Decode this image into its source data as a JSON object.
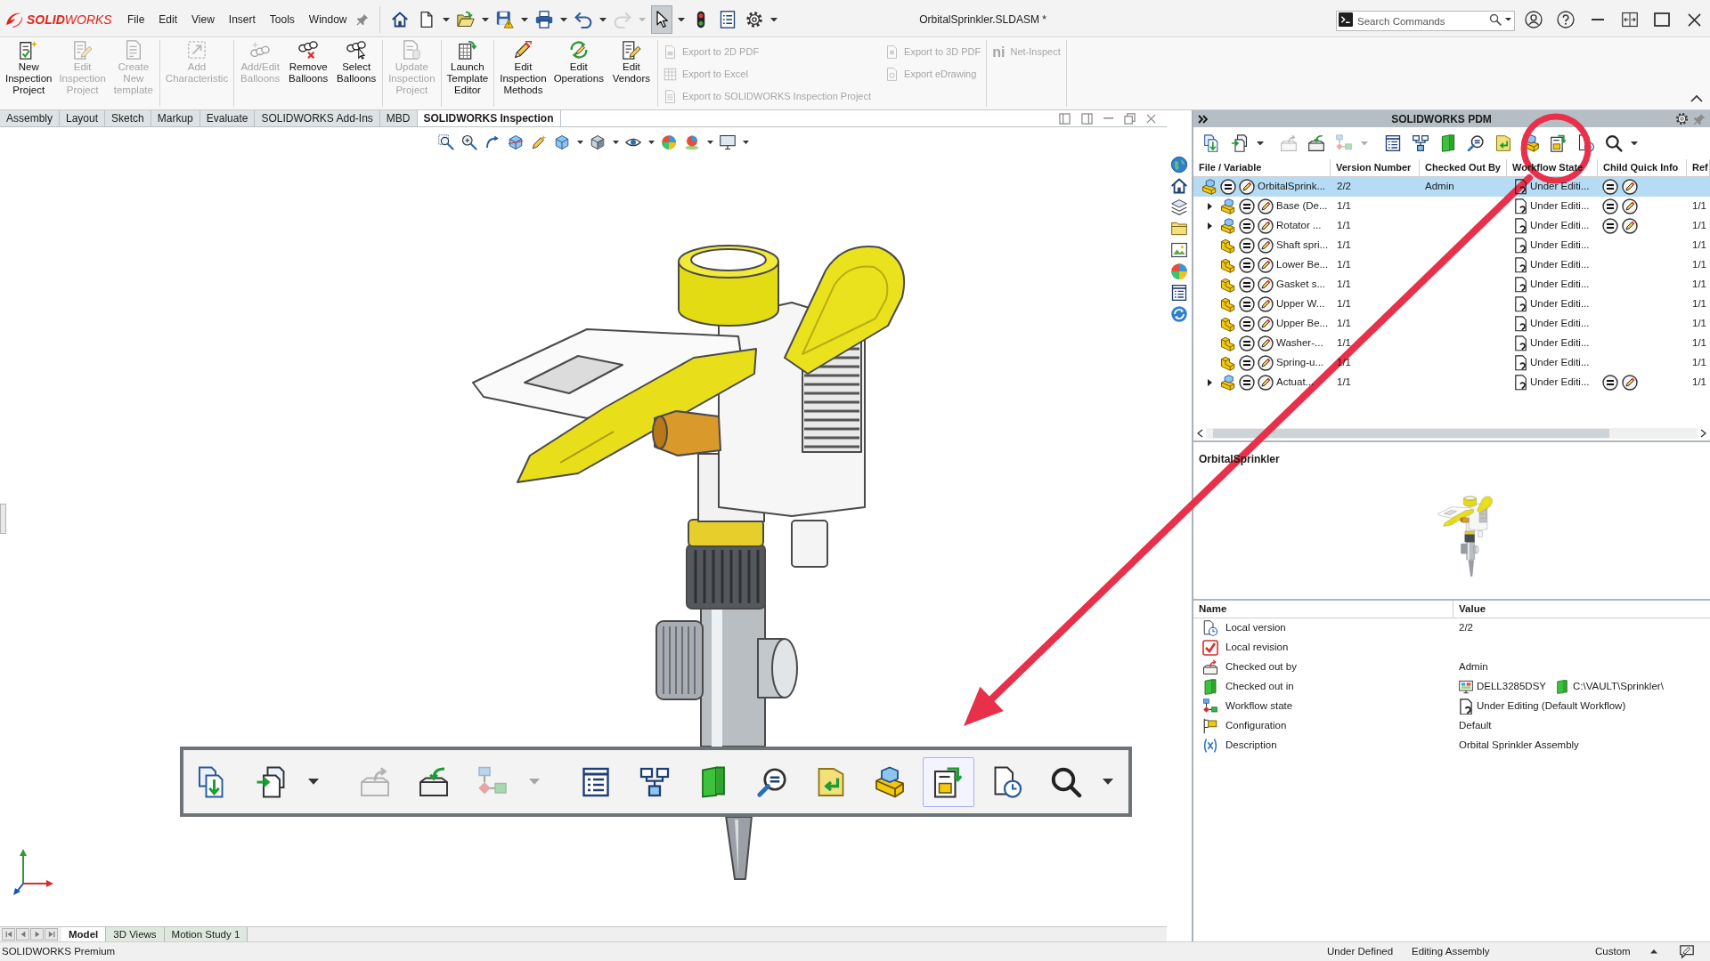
{
  "title_bar": {
    "logo": "**SOLID**WORKS",
    "menu": [
      "File",
      "Edit",
      "View",
      "Insert",
      "Tools",
      "Window"
    ],
    "quick_access": [
      {
        "kind": "button",
        "disabled": false,
        "selected": false
      },
      {
        "kind": "button",
        "disabled": false,
        "selected": false
      },
      {
        "kind": "arrow",
        "disabled": false,
        "selected": false
      },
      {
        "kind": "button",
        "disabled": false,
        "selected": false
      },
      {
        "kind": "arrow",
        "disabled": false,
        "selected": false
      },
      {
        "kind": "button",
        "disabled": false,
        "selected": false
      },
      {
        "kind": "arrow",
        "disabled": false,
        "selected": false
      },
      {
        "kind": "button",
        "disabled": false,
        "selected": false
      },
      {
        "kind": "arrow",
        "disabled": false,
        "selected": false
      },
      {
        "kind": "button",
        "disabled": false,
        "selected": false
      },
      {
        "kind": "arrow",
        "disabled": false,
        "selected": false
      },
      {
        "kind": "button",
        "disabled": true,
        "selected": false
      },
      {
        "kind": "arrow",
        "disabled": true,
        "selected": false
      },
      {
        "kind": "button",
        "disabled": false,
        "selected": true
      },
      {
        "kind": "arrow",
        "disabled": false,
        "selected": false
      },
      {
        "kind": "button",
        "disabled": false,
        "selected": false
      },
      {
        "kind": "button",
        "disabled": false,
        "selected": false
      },
      {
        "kind": "button",
        "disabled": false,
        "selected": false
      },
      {
        "kind": "arrow",
        "disabled": false,
        "selected": false
      }
    ],
    "document_title": "OrbitalSprinkler.SLDASM *",
    "search": {
      "placeholder": "Search Commands"
    }
  },
  "ribbon": {
    "groups": [
      {
        "kind": "large",
        "buttons": [
          {
            "label": "New Inspection Project",
            "disabled": false
          },
          {
            "label": "Edit Inspection Project",
            "disabled": true
          },
          {
            "label": "Create New template",
            "disabled": true
          }
        ]
      },
      {
        "kind": "large",
        "buttons": [
          {
            "label": "Add Characteristic",
            "disabled": true
          }
        ]
      },
      {
        "kind": "large",
        "buttons": [
          {
            "label": "Add/Edit Balloons",
            "disabled": true
          },
          {
            "label": "Remove Balloons",
            "disabled": false
          },
          {
            "label": "Select Balloons",
            "disabled": false
          }
        ]
      },
      {
        "kind": "large",
        "buttons": [
          {
            "label": "Update Inspection Project",
            "disabled": true
          }
        ]
      },
      {
        "kind": "large",
        "buttons": [
          {
            "label": "Launch Template Editor",
            "disabled": false
          }
        ]
      },
      {
        "kind": "large",
        "buttons": [
          {
            "label": "Edit Inspection Methods",
            "disabled": false
          },
          {
            "label": "Edit Operations",
            "disabled": false
          },
          {
            "label": "Edit Vendors",
            "disabled": false
          }
        ]
      },
      {
        "kind": "small",
        "columns": [
          [
            {
              "label": "Export to 2D PDF",
              "disabled": true
            },
            {
              "label": "Export to Excel",
              "disabled": true
            },
            {
              "label": "Export to SOLIDWORKS Inspection Project",
              "disabled": true
            }
          ],
          [
            {
              "label": "Export to 3D PDF",
              "disabled": true
            },
            {
              "label": "Export eDrawing",
              "disabled": true
            }
          ]
        ]
      },
      {
        "kind": "small",
        "columns": [
          [
            {
              "label": "Net-Inspect",
              "logo": "ni",
              "disabled": true
            }
          ]
        ]
      }
    ]
  },
  "tabs": [
    {
      "label": "Assembly",
      "selected": false
    },
    {
      "label": "Layout",
      "selected": false
    },
    {
      "label": "Sketch",
      "selected": false
    },
    {
      "label": "Markup",
      "selected": false
    },
    {
      "label": "Evaluate",
      "selected": false
    },
    {
      "label": "SOLIDWORKS Add-Ins",
      "selected": false
    },
    {
      "label": "MBD",
      "selected": false
    },
    {
      "label": "SOLIDWORKS Inspection",
      "selected": true
    }
  ],
  "viewport": {
    "callout_toolbar": [
      {
        "kind": "button",
        "disabled": false,
        "selected": false
      },
      {
        "kind": "button",
        "disabled": false,
        "selected": false
      },
      {
        "kind": "arrow",
        "disabled": false,
        "selected": false
      },
      {
        "kind": "button",
        "disabled": true,
        "selected": false
      },
      {
        "kind": "button",
        "disabled": false,
        "selected": false
      },
      {
        "kind": "button",
        "disabled": true,
        "selected": false
      },
      {
        "kind": "arrow",
        "disabled": true,
        "selected": false
      },
      {
        "kind": "button",
        "disabled": false,
        "selected": false
      },
      {
        "kind": "button",
        "disabled": false,
        "selected": false
      },
      {
        "kind": "button",
        "disabled": false,
        "selected": false
      },
      {
        "kind": "button",
        "disabled": false,
        "selected": false
      },
      {
        "kind": "button",
        "disabled": false,
        "selected": false
      },
      {
        "kind": "button",
        "disabled": false,
        "selected": false
      },
      {
        "kind": "button",
        "disabled": false,
        "selected": true
      },
      {
        "kind": "button",
        "disabled": false,
        "selected": false
      },
      {
        "kind": "button",
        "disabled": false,
        "selected": false
      },
      {
        "kind": "arrow",
        "disabled": false,
        "selected": false
      }
    ]
  },
  "pdm": {
    "title": "SOLIDWORKS PDM",
    "toolbar": [
      {
        "kind": "button",
        "disabled": false
      },
      {
        "kind": "button",
        "disabled": false
      },
      {
        "kind": "arrow",
        "disabled": false
      },
      {
        "kind": "button",
        "disabled": true
      },
      {
        "kind": "button",
        "disabled": false
      },
      {
        "kind": "button",
        "disabled": true
      },
      {
        "kind": "arrow",
        "disabled": true
      },
      {
        "kind": "button",
        "disabled": false
      },
      {
        "kind": "button",
        "disabled": false
      },
      {
        "kind": "button",
        "disabled": false
      },
      {
        "kind": "button",
        "disabled": false
      },
      {
        "kind": "button",
        "disabled": false
      },
      {
        "kind": "button",
        "disabled": false
      },
      {
        "kind": "button",
        "disabled": false
      },
      {
        "kind": "button",
        "disabled": false
      },
      {
        "kind": "button",
        "disabled": false
      },
      {
        "kind": "arrow",
        "disabled": false
      }
    ],
    "columns": [
      "File / Variable",
      "Version Number",
      "Checked Out By",
      "Workflow State",
      "Child Quick Info",
      "Ref"
    ],
    "files": [
      {
        "name": "OrbitalSprink...",
        "kind": "assembly",
        "expandable": false,
        "version": "2/2",
        "checked_out_by": "Admin",
        "state": "Under Editi...",
        "quick_info": true,
        "selected": true,
        "children": [
          {
            "name": "Base (De...",
            "kind": "assembly",
            "expandable": true,
            "version": "1/1",
            "state": "Under Editi...",
            "quick_info": true,
            "ref": "1/1",
            "selected": false
          },
          {
            "name": "Rotator ...",
            "kind": "assembly",
            "expandable": true,
            "version": "1/1",
            "state": "Under Editi...",
            "quick_info": true,
            "ref": "1/1",
            "selected": false
          },
          {
            "name": "Shaft spri...",
            "kind": "part",
            "expandable": false,
            "version": "1/1",
            "state": "Under Editi...",
            "quick_info": false,
            "ref": "1/1",
            "selected": false
          },
          {
            "name": "Lower Be...",
            "kind": "part",
            "expandable": false,
            "version": "1/1",
            "state": "Under Editi...",
            "quick_info": false,
            "ref": "1/1",
            "selected": false
          },
          {
            "name": "Gasket s...",
            "kind": "part",
            "expandable": false,
            "version": "1/1",
            "state": "Under Editi...",
            "quick_info": false,
            "ref": "1/1",
            "selected": false
          },
          {
            "name": "Upper W...",
            "kind": "part",
            "expandable": false,
            "version": "1/1",
            "state": "Under Editi...",
            "quick_info": false,
            "ref": "1/1",
            "selected": false
          },
          {
            "name": "Upper Be...",
            "kind": "part",
            "expandable": false,
            "version": "1/1",
            "state": "Under Editi...",
            "quick_info": false,
            "ref": "1/1",
            "selected": false
          },
          {
            "name": "Washer-...",
            "kind": "part",
            "expandable": false,
            "version": "1/1",
            "state": "Under Editi...",
            "quick_info": false,
            "ref": "1/1",
            "selected": false
          },
          {
            "name": "Spring-u...",
            "kind": "part",
            "expandable": false,
            "version": "1/1",
            "state": "Under Editi...",
            "quick_info": false,
            "ref": "1/1",
            "selected": false
          },
          {
            "name": "Actuat...",
            "kind": "assembly",
            "expandable": true,
            "version": "1/1",
            "state": "Under Editi...",
            "quick_info": true,
            "ref": "1/1",
            "selected": false
          }
        ]
      }
    ],
    "preview": {
      "title": "OrbitalSprinkler"
    },
    "properties": {
      "columns": [
        "Name",
        "Value"
      ],
      "rows": [
        {
          "name": "Local version",
          "value": "2/2"
        },
        {
          "name": "Local revision"
        },
        {
          "name": "Checked out by",
          "value": "Admin"
        },
        {
          "name": "Checked out in",
          "values": [
            "DELL3285DSY",
            "C:\\VAULT\\Sprinkler\\"
          ]
        },
        {
          "name": "Workflow state",
          "value": "Under Editing (Default Workflow)"
        },
        {
          "name": "Configuration",
          "value": "Default"
        },
        {
          "name": "Description",
          "value": "Orbital Sprinkler Assembly"
        }
      ]
    }
  },
  "bottom_tabs": [
    {
      "label": "Model",
      "selected": true
    },
    {
      "label": "3D Views",
      "selected": false
    },
    {
      "label": "Motion Study 1",
      "selected": false
    }
  ],
  "status_bar": {
    "product": "SOLIDWORKS Premium",
    "items": [
      "Under Defined",
      "Editing Assembly",
      "Custom"
    ]
  }
}
